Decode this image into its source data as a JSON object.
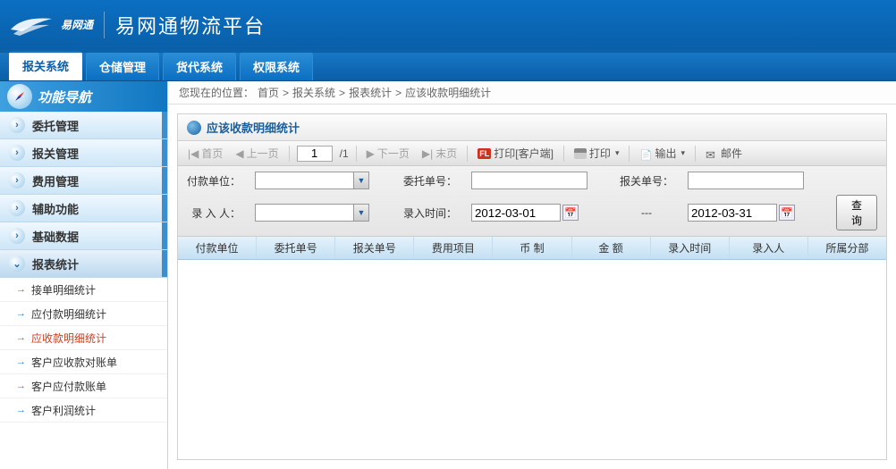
{
  "header": {
    "logo_small": "易网通",
    "site_title": "易网通物流平台"
  },
  "nav_tabs": [
    {
      "label": "报关系统",
      "active": true
    },
    {
      "label": "仓储管理",
      "active": false
    },
    {
      "label": "货代系统",
      "active": false
    },
    {
      "label": "权限系统",
      "active": false
    }
  ],
  "sidebar": {
    "title": "功能导航",
    "sections": [
      {
        "label": "委托管理"
      },
      {
        "label": "报关管理"
      },
      {
        "label": "费用管理"
      },
      {
        "label": "辅助功能"
      },
      {
        "label": "基础数据"
      },
      {
        "label": "报表统计",
        "active": true
      }
    ],
    "sub_items": [
      {
        "label": "接单明细统计"
      },
      {
        "label": "应付款明细统计"
      },
      {
        "label": "应收款明细统计",
        "active": true
      },
      {
        "label": "客户应收款对账单"
      },
      {
        "label": "客户应付款账单"
      },
      {
        "label": "客户利润统计"
      }
    ]
  },
  "breadcrumb": {
    "prefix": "您现在的位置：",
    "items": [
      "首页",
      "报关系统",
      "报表统计",
      "应该收款明细统计"
    ]
  },
  "panel": {
    "title": "应该收款明细统计"
  },
  "toolbar": {
    "first": "首页",
    "prev": "上一页",
    "page_value": "1",
    "page_total": "/1",
    "next": "下一页",
    "last": "末页",
    "print_client": "打印[客户端]",
    "print": "打印",
    "export": "输出",
    "mail": "邮件"
  },
  "filters": {
    "pay_unit_label": "付款单位：",
    "pay_unit_value": "",
    "entrust_no_label": "委托单号：",
    "entrust_no_value": "",
    "customs_no_label": "报关单号：",
    "customs_no_value": "",
    "entry_person_label": "录 入 人：",
    "entry_person_value": "",
    "entry_time_label": "录入时间：",
    "date_from": "2012-03-01",
    "date_to_sep": "---",
    "date_to": "2012-03-31",
    "query_btn": "查询"
  },
  "table": {
    "columns": [
      "付款单位",
      "委托单号",
      "报关单号",
      "费用项目",
      "币 制",
      "金 额",
      "录入时间",
      "录入人",
      "所属分部"
    ]
  }
}
